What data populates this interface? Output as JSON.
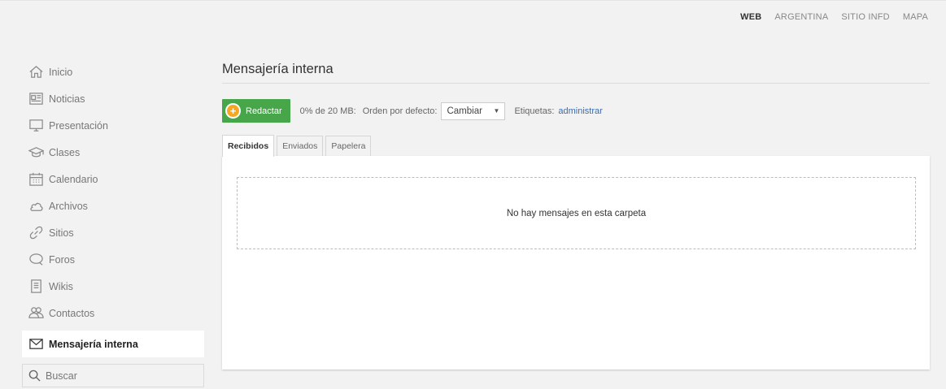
{
  "topnav": [
    "WEB",
    "ARGENTINA",
    "SITIO INFD",
    "MAPA"
  ],
  "sidebar": {
    "items": [
      {
        "label": "Inicio",
        "icon": "home-icon"
      },
      {
        "label": "Noticias",
        "icon": "news-icon"
      },
      {
        "label": "Presentación",
        "icon": "monitor-icon"
      },
      {
        "label": "Clases",
        "icon": "graduation-cap-icon"
      },
      {
        "label": "Calendario",
        "icon": "calendar-icon"
      },
      {
        "label": "Archivos",
        "icon": "cloud-icon"
      },
      {
        "label": "Sitios",
        "icon": "link-icon"
      },
      {
        "label": "Foros",
        "icon": "chat-bubble-icon"
      },
      {
        "label": "Wikis",
        "icon": "document-icon"
      },
      {
        "label": "Contactos",
        "icon": "contacts-icon"
      }
    ],
    "active": {
      "label": "Mensajería interna",
      "icon": "envelope-icon"
    },
    "search": "Buscar"
  },
  "main": {
    "title": "Mensajería interna",
    "toolbar": {
      "compose_label": "Redactar",
      "quota": "0% de 20 MB:",
      "order_label": "Orden por defecto:",
      "order_value": "Cambiar",
      "labels_label": "Etiquetas:",
      "labels_link": "administrar"
    },
    "tabs": [
      "Recibidos",
      "Enviados",
      "Papelera"
    ],
    "active_tab": "Recibidos",
    "empty_message": "No hay mensajes en esta carpeta"
  },
  "colors": {
    "compose_button": "#47a64a",
    "compose_plus": "#f5a623",
    "link": "#3b6bb0"
  }
}
